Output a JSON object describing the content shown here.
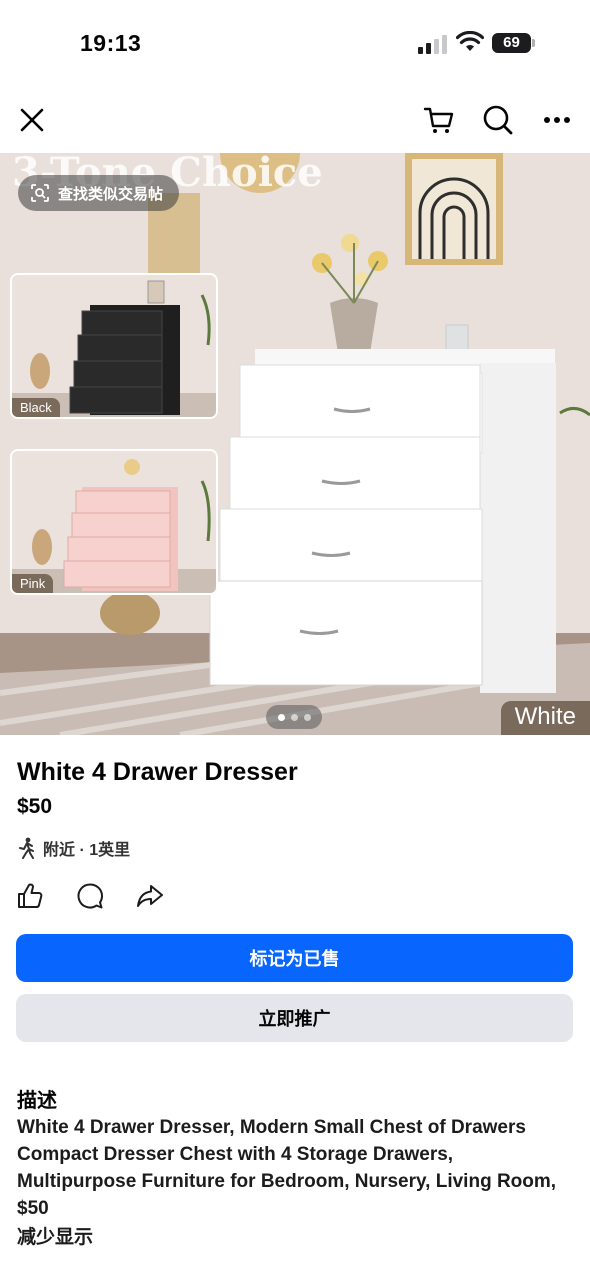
{
  "status_bar": {
    "time": "19:13",
    "battery": "69",
    "icons": [
      "cellular-signal-icon",
      "wifi-icon",
      "battery-icon"
    ]
  },
  "nav": {
    "icons": [
      "close-icon",
      "cart-icon",
      "search-icon",
      "more-icon"
    ]
  },
  "photo": {
    "similar_button": "查找类似交易帖",
    "banner_text": "3-Tone Choice",
    "variants": [
      "Black",
      "Pink"
    ],
    "main_variant": "White",
    "page_count": 3,
    "active_page": 1
  },
  "listing": {
    "title": "White 4 Drawer Dresser",
    "price": "$50",
    "location": "附近 · 1英里"
  },
  "actions": {
    "icons": [
      "like-icon",
      "comment-icon",
      "share-icon"
    ]
  },
  "buttons": {
    "mark_sold": "标记为已售",
    "boost": "立即推广"
  },
  "description": {
    "heading": "描述",
    "text": "White 4 Drawer Dresser, Modern Small Chest of Drawers Compact Dresser Chest with 4 Storage Drawers, Multipurpose Furniture for Bedroom, Nursery, Living Room, $50",
    "toggle": "减少显示"
  },
  "colors": {
    "primary_button": "#0866ff",
    "secondary_button": "#e4e6eb",
    "label_background": "#7a6a5c"
  }
}
